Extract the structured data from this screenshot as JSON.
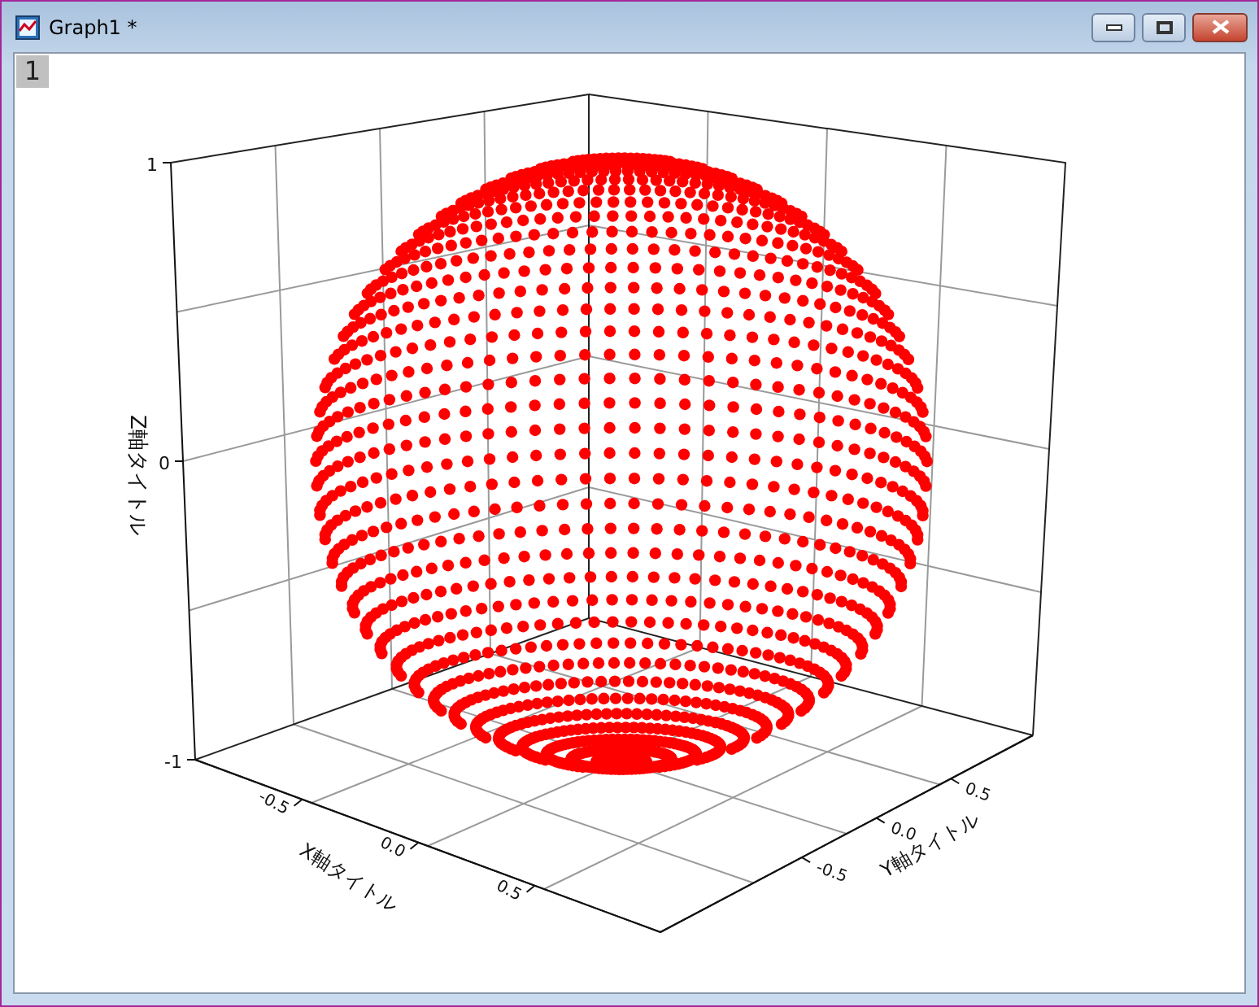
{
  "window": {
    "title": "Graph1 *"
  },
  "layer_tab": {
    "label": "1"
  },
  "graph": {
    "z_axis": {
      "title": "Z軸タイトル",
      "tick_labels": [
        "1",
        "0",
        "-1"
      ]
    },
    "x_axis": {
      "title": "X軸タイトル",
      "tick_labels": [
        "-0.5",
        "0.0",
        "0.5"
      ]
    },
    "y_axis": {
      "title": "Y軸タイトル",
      "tick_labels": [
        "-0.5",
        "0.0",
        "0.5"
      ]
    }
  }
}
